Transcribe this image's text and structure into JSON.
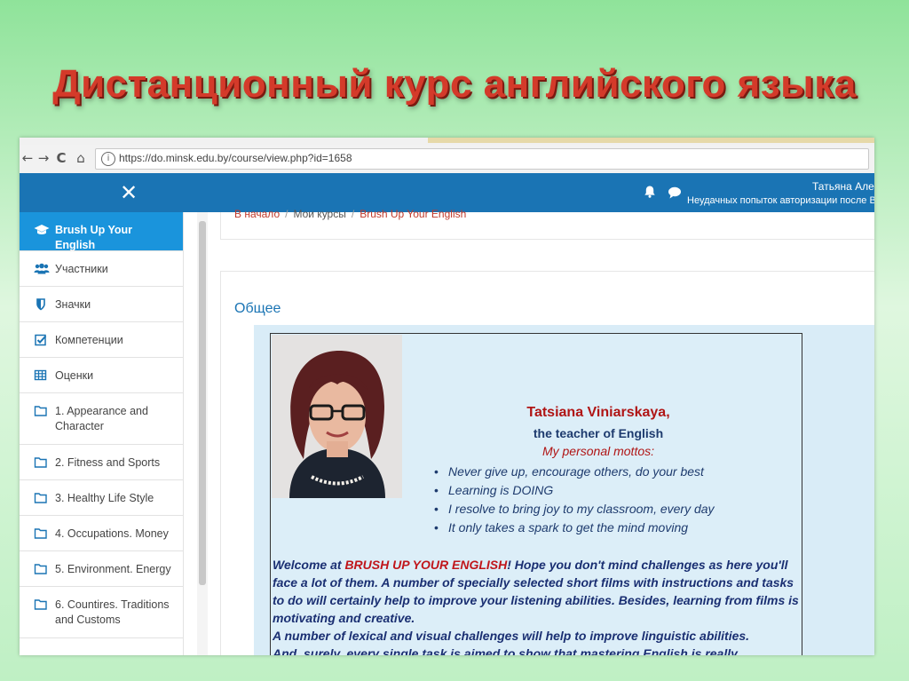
{
  "slide": {
    "title": "Дистанционный курс английского языка"
  },
  "browser": {
    "url": "https://do.minsk.edu.by/course/view.php?id=1658",
    "back_glyph": "←",
    "forward_glyph": "→",
    "reload_glyph": "C",
    "home_glyph": "⌂",
    "info_glyph": "i"
  },
  "navbar": {
    "close_glyph": "✕",
    "user_name": "Татьяна Але",
    "login_warning": "Неудачных попыток авторизации после Ва"
  },
  "sidebar": {
    "items": [
      {
        "label": "Brush Up Your English",
        "icon": "graduation-cap-icon",
        "active": true
      },
      {
        "label": "Участники",
        "icon": "users-icon"
      },
      {
        "label": "Значки",
        "icon": "shield-icon"
      },
      {
        "label": "Компетенции",
        "icon": "checkbox-icon"
      },
      {
        "label": "Оценки",
        "icon": "table-icon"
      },
      {
        "label": "1. Appearance and Character",
        "icon": "folder-icon"
      },
      {
        "label": "2. Fitness and Sports",
        "icon": "folder-icon"
      },
      {
        "label": "3. Healthy Life Style",
        "icon": "folder-icon"
      },
      {
        "label": "4. Occupations. Money",
        "icon": "folder-icon"
      },
      {
        "label": "5. Environment. Energy",
        "icon": "folder-icon"
      },
      {
        "label": "6. Countires. Traditions and Customs",
        "icon": "folder-icon"
      }
    ]
  },
  "breadcrumb": {
    "home": "В начало",
    "separator": "/",
    "my_courses": "Мои курсы",
    "course": "Brush Up Your English"
  },
  "section": {
    "title": "Общее"
  },
  "teacher": {
    "name": "Tatsiana Viniarskaya,",
    "role": "the teacher of English",
    "mottos_heading": "My personal mottos:",
    "mottos": [
      "Never give up, encourage others, do your best",
      "Learning is DOING",
      "I resolve to bring joy to my classroom, every day",
      "It only takes a spark to get the mind moving"
    ]
  },
  "welcome": {
    "prefix": "Welcome at ",
    "brand": "BRUSH UP YOUR ENGLISH",
    "text1": "! Hope you don't mind challenges as here you'll face a lot of them. A number of specially selected short films with instructions and tasks to do will certainly help to improve your listening abilities. Besides, learning from films is motivating and creative.",
    "text2": "A number of lexical and visual challenges will help to improve linguistic abilities.",
    "text3": "And, surely, every single task is aimed to show that mastering English is really"
  },
  "colors": {
    "navbar": "#1a74b4",
    "sidebar_active": "#1a94dc",
    "title_red": "#d43a2a",
    "name_red": "#b01515",
    "text_navy": "#1e3b6e"
  }
}
